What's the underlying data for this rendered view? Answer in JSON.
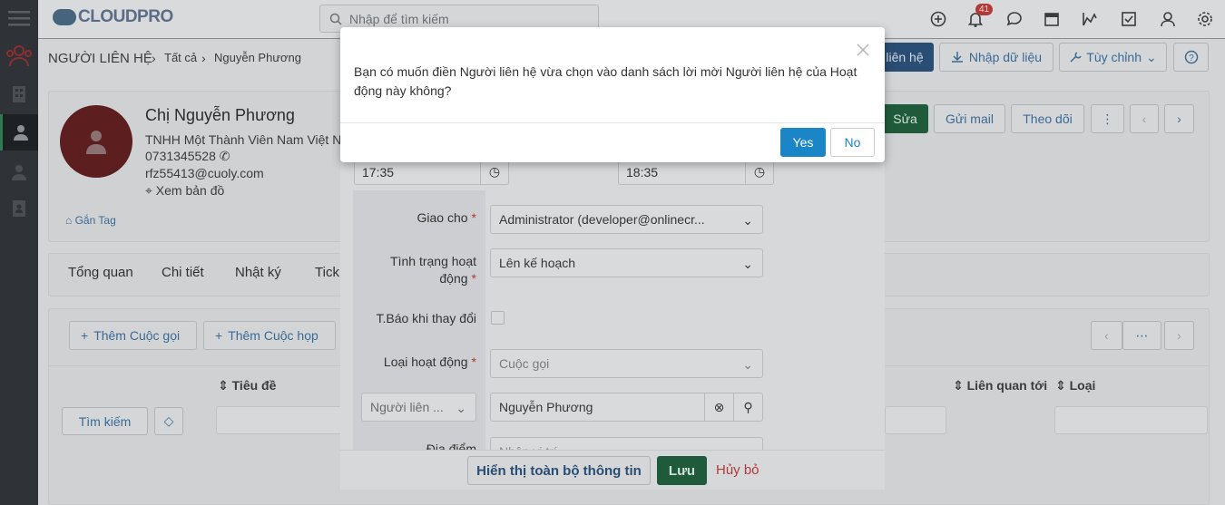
{
  "app": {
    "logo": "CLOUDPRO"
  },
  "search": {
    "placeholder": "Nhập để tìm kiếm"
  },
  "notifications": {
    "count": "41"
  },
  "breadcrumb": {
    "module": "NGƯỜI LIÊN HỆ",
    "level1": "Tất cả",
    "level2": "Nguyễn Phương"
  },
  "header_actions": {
    "add_contact": "liên hệ",
    "import": "Nhập dữ liệu",
    "customize": "Tùy chỉnh"
  },
  "record_actions": {
    "edit": "Sửa",
    "send_mail": "Gửi mail",
    "follow": "Theo dõi"
  },
  "contact": {
    "name": "Chị Nguyễn Phương",
    "company": "TNHH Một Thành Viên Nam Việt N",
    "phone": "0731345528",
    "email": "rfz55413@cuoly.com",
    "map": "Xem bản đồ",
    "tag": "Gắn Tag"
  },
  "tabs": [
    "Tổng quan",
    "Chi tiết",
    "Nhật ký",
    "Tick"
  ],
  "activity_buttons": {
    "add_call": "Thêm Cuộc gọi",
    "add_meeting": "Thêm Cuộc họp"
  },
  "table": {
    "col_title": "Tiêu đề",
    "col_related": "Liên quan tới",
    "col_type": "Loại",
    "search_button": "Tìm kiếm"
  },
  "form": {
    "start_time": "17:35",
    "end_time": "18:35",
    "assigned_label": "Giao cho",
    "assigned_value": "Administrator (developer@onlinecr...",
    "status_label": "Tình trạng hoạt động",
    "status_value": "Lên kế hoạch",
    "notify_label": "T.Báo khi thay đổi",
    "activity_type_label": "Loại hoạt động",
    "activity_type_value": "Cuộc gọi",
    "contact_select": "Người liên ...",
    "contact_value": "Nguyễn Phương",
    "location_label": "Địa điểm",
    "location_placeholder": "Nhập vị trí",
    "show_all": "Hiển thị toàn bộ thông tin",
    "save": "Lưu",
    "cancel": "Hủy bỏ"
  },
  "modal": {
    "message": "Bạn có muốn điền Người liên hệ vừa chọn vào danh sách lời mời Người liên hệ của Hoạt động này không?",
    "yes": "Yes",
    "no": "No"
  },
  "colors": {
    "primary": "#1a86c8",
    "sidebar": "#2f3338",
    "danger": "#b33a3a"
  }
}
